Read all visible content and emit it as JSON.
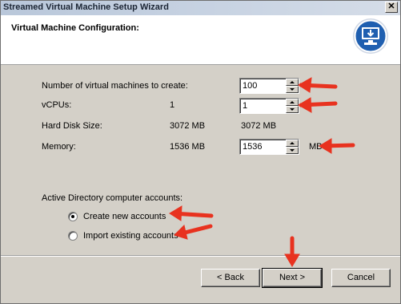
{
  "window": {
    "title": "Streamed Virtual Machine Setup Wizard"
  },
  "header": {
    "heading": "Virtual Machine Configuration:",
    "logo_icon": "vm-download-icon"
  },
  "config": {
    "num_vms_label": "Number of virtual machines to create:",
    "num_vms_value": "100",
    "vcpus_label": "vCPUs:",
    "vcpus_default": "1",
    "vcpus_value": "1",
    "hdd_label": "Hard Disk Size:",
    "hdd_default": "3072 MB",
    "hdd_value": "3072 MB",
    "memory_label": "Memory:",
    "memory_default": "1536 MB",
    "memory_value": "1536",
    "memory_unit": "MB"
  },
  "ad": {
    "label": "Active Directory computer accounts:",
    "options": [
      {
        "label": "Create new accounts",
        "checked": true
      },
      {
        "label": "Import existing accounts",
        "checked": false
      }
    ]
  },
  "footer": {
    "back": "< Back",
    "next": "Next >",
    "cancel": "Cancel"
  },
  "colors": {
    "arrow": "#e8321f",
    "logo_blue": "#1f5fb0"
  }
}
